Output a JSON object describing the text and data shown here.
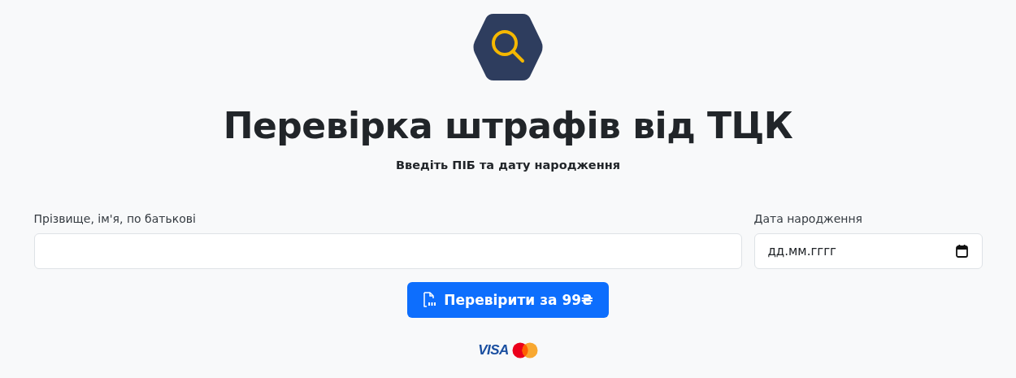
{
  "title": "Перевірка штрафів від ТЦК",
  "subtitle": "Введіть ПІБ та дату народження",
  "fields": [
    {
      "kind": "text",
      "label": "Прізвище, ім'я, по батькові"
    },
    {
      "kind": "date",
      "label": "Дата народження",
      "placeholder": "дд.мм.гггг"
    }
  ],
  "submit_button": {
    "label": "Перевірити за 99₴"
  },
  "payment": {
    "visa": "VISA"
  }
}
